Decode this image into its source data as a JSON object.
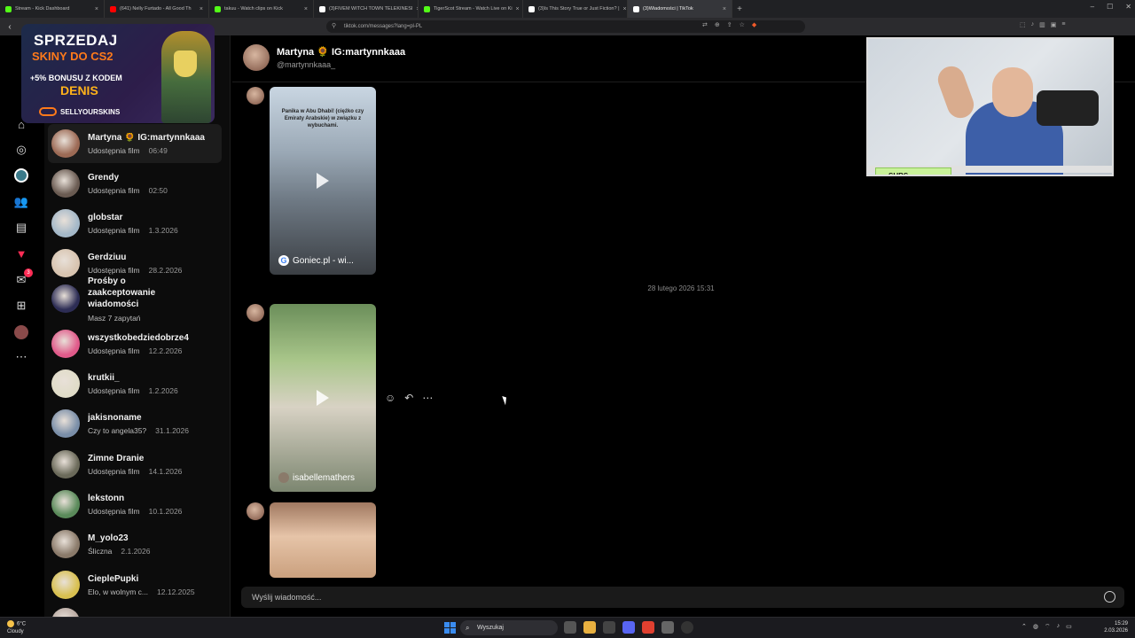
{
  "browser": {
    "tabs": [
      {
        "title": "Stream - Kick Dashboard",
        "color": "#53fc18"
      },
      {
        "title": "(641) Nelly Furtado - All Good Th",
        "color": "#ff0000"
      },
      {
        "title": "takuu - Watch clips on Kick",
        "color": "#53fc18"
      },
      {
        "title": "(3)FIVEM WITCH TOWN TELEKINESI",
        "color": "#ffffff"
      },
      {
        "title": "TigerScot Stream - Watch Live on Ki",
        "color": "#53fc18"
      },
      {
        "title": "(3)Is This Story True or Just Fiction? |",
        "color": "#ffffff"
      },
      {
        "title": "(3)Wiadomości | TikTok",
        "color": "#ffffff",
        "active": true
      }
    ],
    "url": "tiktok.com/messages?lang=pl-PL"
  },
  "ad": {
    "line1": "SPRZEDAJ",
    "line2": "SKINY DO CS2",
    "line3": "+5% BONUSU Z KODEM",
    "line4": "DENIS",
    "brand": "SELLYOURSKINS"
  },
  "rail": {
    "notifications_badge": "3"
  },
  "conversations": [
    {
      "name": "Martyna 🌻 IG:martynnkaaa",
      "sub": "Udostępnia film",
      "when": "06:49",
      "active": true,
      "color": "#9c6a55"
    },
    {
      "name": "Grendy",
      "sub": "Udostępnia film",
      "when": "02:50",
      "color": "#6a5b52"
    },
    {
      "name": "globstar",
      "sub": "Udostępnia film",
      "when": "1.3.2026",
      "color": "#a4b8c8"
    },
    {
      "name": "Gerdziuu",
      "sub": "Udostępnia film",
      "when": "28.2.2026",
      "color": "#d8c4b0"
    },
    {
      "name": "Prośby o zaakceptowanie wiadomości",
      "sub": "Masz 7 zapytań",
      "when": "",
      "color": "#2d2d55"
    },
    {
      "name": "wszystkobedziedobrze4",
      "sub": "Udostępnia film",
      "when": "12.2.2026",
      "color": "#e05a8a"
    },
    {
      "name": "krutkii_",
      "sub": "Udostępnia film",
      "when": "1.2.2026",
      "color": "#e0dcc8"
    },
    {
      "name": "jakisnoname",
      "sub": "Czy to angela35?",
      "when": "31.1.2026",
      "color": "#7a8ea8"
    },
    {
      "name": "Zimne Dranie",
      "sub": "Udostępnia film",
      "when": "14.1.2026",
      "color": "#6b6a5a"
    },
    {
      "name": "lekstonn",
      "sub": "Udostępnia film",
      "when": "10.1.2026",
      "color": "#5a8a5a"
    },
    {
      "name": "M_yolo23",
      "sub": "Śliczna",
      "when": "2.1.2026",
      "color": "#8a7a6a"
    },
    {
      "name": "CieplePupki",
      "sub": "Elo, w wolnym c...",
      "when": "12.12.2025",
      "color": "#d8c050"
    },
    {
      "name": "Lunar",
      "sub": "",
      "when": "",
      "color": "#b8a8a0"
    }
  ],
  "chat": {
    "name": "Martyna 🌻 IG:martynnkaaa",
    "handle": "@martynnkaaa_",
    "date_separator": "28 lutego 2026 15:31",
    "video1_overlay": "Panika w Abu Dhabi! (ciężko czy Emiraty Arabskie) w związku z wybuchami.",
    "video1_caption": "Goniec.pl - wi...",
    "video2_caption": "isabellemathers",
    "composer_placeholder": "Wyślij wiadomość..."
  },
  "cam": {
    "label": "SUBS"
  },
  "taskbar": {
    "temp": "6°C",
    "weather": "Cloudy",
    "search": "Wyszukaj",
    "time": "15:29",
    "date": "2.03.2026"
  }
}
